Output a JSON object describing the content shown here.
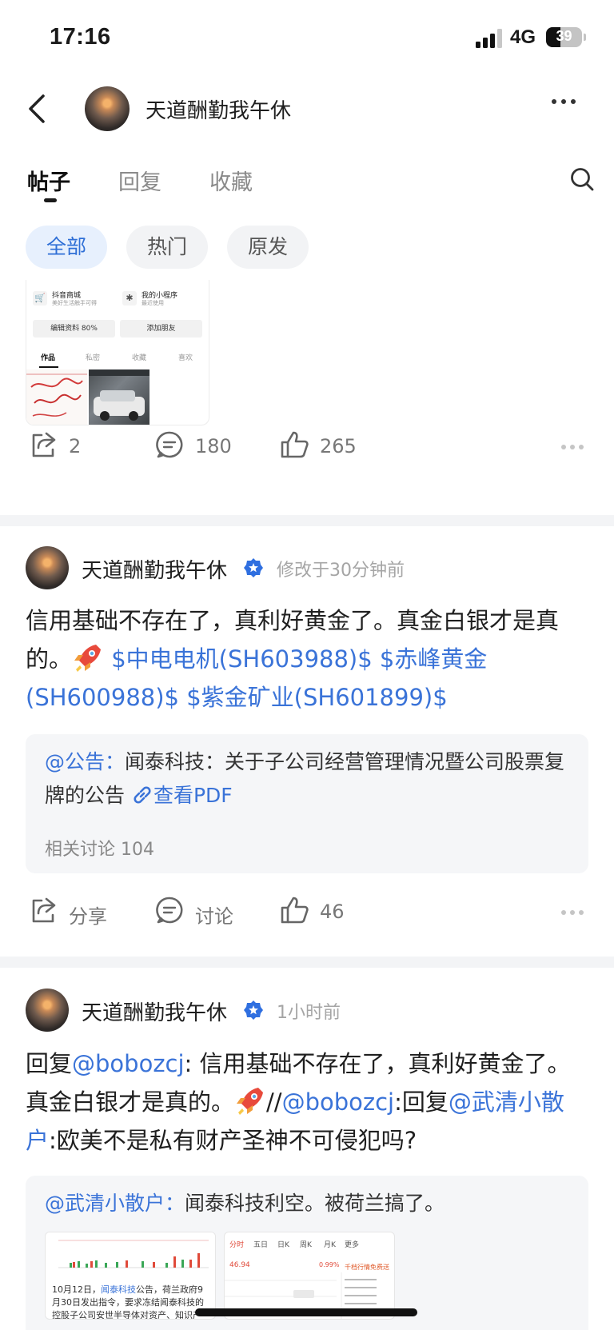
{
  "status_bar": {
    "time": "17:16",
    "network": "4G",
    "battery": "39"
  },
  "nav": {
    "title": "天道酬勤我午休"
  },
  "tabs": [
    {
      "label": "帖子",
      "active": true
    },
    {
      "label": "回复",
      "active": false
    },
    {
      "label": "收藏",
      "active": false
    }
  ],
  "filters": [
    {
      "label": "全部",
      "active": true
    },
    {
      "label": "热门",
      "active": false
    },
    {
      "label": "原发",
      "active": false
    }
  ],
  "preview_card": {
    "mall_title": "抖音商城",
    "mall_sub": "美好生活触手可得",
    "mini_title": "我的小程序",
    "mini_sub": "最近使用",
    "edit_btn": "编辑资料 80%",
    "add_btn": "添加朋友",
    "tab_works": "作品",
    "tab_private": "私密",
    "tab_fav": "收藏",
    "tab_like": "喜欢"
  },
  "post0_actions": {
    "share": "2",
    "comment": "180",
    "like": "265"
  },
  "post1": {
    "author": "天道酬勤我午休",
    "time": "修改于30分钟前",
    "text_main": "信用基础不存在了，真利好黄金了。真金白银才是真的。",
    "stock1": "$中电电机(SH603988)$",
    "stock2": "$赤峰黄金(SH600988)$",
    "stock3": "$紫金矿业(SH601899)$",
    "quote_mention": "@公告：",
    "quote_text": "闻泰科技：关于子公司经营管理情况暨公司股票复牌的公告",
    "quote_link": "查看PDF",
    "quote_meta": "相关讨论 104",
    "share_label": "分享",
    "comment_label": "讨论",
    "like_count": "46"
  },
  "post2": {
    "author": "天道酬勤我午休",
    "time": "1小时前",
    "reply_prefix": "回复",
    "mention1": "@bobozcj",
    "text1": ": 信用基础不存在了，真利好黄金了。真金白银才是真的。",
    "slashes": "//",
    "mention2": "@bobozcj",
    "text2": ":回复",
    "mention3": "@武清小散户",
    "text3": ":欧美不是私有财产圣神不可侵犯吗?",
    "quote_mention": "@武清小散户：",
    "quote_text": "闻泰科技利空。被荷兰搞了。",
    "thumb1_line1": "10月12日，",
    "thumb1_link": "闻泰科技",
    "thumb1_line1b": "公告，荷兰政府9",
    "thumb1_line2": "月30日发出指令，要求冻结闻泰科技的",
    "thumb1_line3": "控股子公司安世半导体对资产、知识产",
    "thumb2_tabs": [
      "分时",
      "五日",
      "日K",
      "周K",
      "月K",
      "更多"
    ],
    "thumb2_price": "46.94",
    "thumb2_pct": "0.99%",
    "thumb2_header": "千档行情免费送"
  },
  "colors": {
    "accent": "#3a73d8",
    "chip_active_bg": "#e7f0fd",
    "separator": "#f3f4f6"
  }
}
